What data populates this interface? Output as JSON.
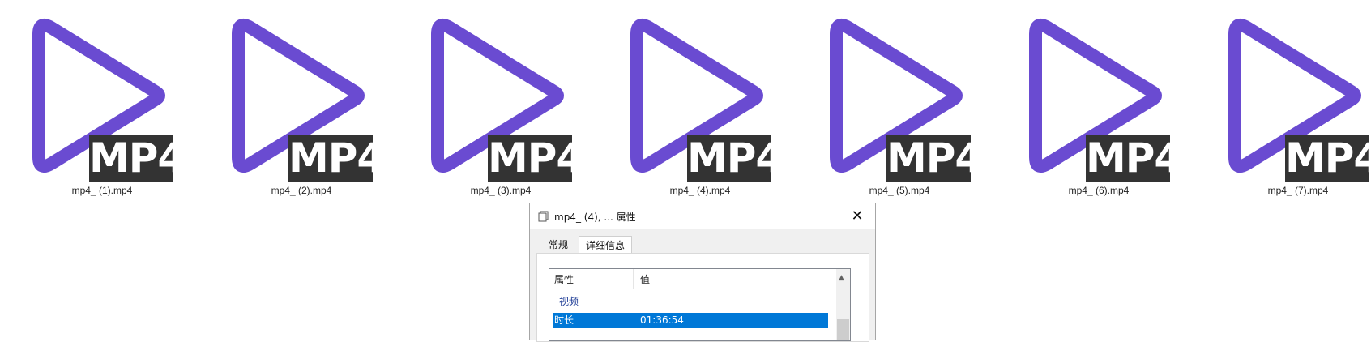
{
  "files": [
    {
      "name": "mp4_ (1).mp4",
      "badge": "MP4"
    },
    {
      "name": "mp4_ (2).mp4",
      "badge": "MP4"
    },
    {
      "name": "mp4_ (3).mp4",
      "badge": "MP4"
    },
    {
      "name": "mp4_ (4).mp4",
      "badge": "MP4"
    },
    {
      "name": "mp4_ (5).mp4",
      "badge": "MP4"
    },
    {
      "name": "mp4_ (6).mp4",
      "badge": "MP4"
    },
    {
      "name": "mp4_ (7).mp4",
      "badge": "MP4"
    }
  ],
  "icon": {
    "semantic": "play-icon",
    "color": "#6a4bd1",
    "badge_bg": "#333333"
  },
  "dialog": {
    "title": "mp4_ (4), ... 属性",
    "close_glyph": "✕",
    "tabs": [
      {
        "label": "常规",
        "active": false
      },
      {
        "label": "详细信息",
        "active": true
      }
    ],
    "columns": {
      "property": "属性",
      "value": "值"
    },
    "group": "视频",
    "selected_row": {
      "key": "时长",
      "value": "01:36:54"
    },
    "selection_color": "#0078d7",
    "scroll_up_glyph": "▲"
  }
}
